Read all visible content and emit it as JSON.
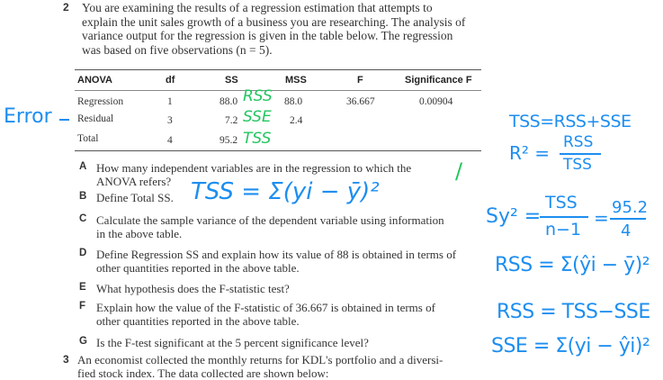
{
  "question2": {
    "number": "2",
    "intro_lines": [
      "You are examining the results of a regression estimation that attempts to",
      "explain the unit sales growth of a business you are researching. The analysis of",
      "variance output for the regression is given in the table below. The regression",
      "was based on five observations (n = 5)."
    ]
  },
  "anova": {
    "headers": [
      "ANOVA",
      "df",
      "SS",
      "MSS",
      "F",
      "Significance F"
    ],
    "rows": [
      {
        "source": "Regression",
        "df": "1",
        "ss": "88.0",
        "mss": "88.0",
        "f": "36.667",
        "sig": "0.00904"
      },
      {
        "source": "Residual",
        "df": "3",
        "ss": "7.2",
        "mss": "2.4",
        "f": "",
        "sig": ""
      },
      {
        "source": "Total",
        "df": "4",
        "ss": "95.2",
        "mss": "",
        "f": "",
        "sig": ""
      }
    ]
  },
  "subquestions": [
    {
      "letter": "A",
      "lines": [
        "How many independent variables are in the regression to which the",
        "ANOVA refers?"
      ]
    },
    {
      "letter": "B",
      "lines": [
        "Define Total SS."
      ]
    },
    {
      "letter": "C",
      "lines": [
        "Calculate the sample variance of the dependent variable using information",
        "in the above table."
      ]
    },
    {
      "letter": "D",
      "lines": [
        "Define Regression SS and explain how its value of 88 is obtained in terms of",
        "other quantities reported in the above table."
      ]
    },
    {
      "letter": "E",
      "lines": [
        "What hypothesis does the F-statistic test?"
      ]
    },
    {
      "letter": "F",
      "lines": [
        "Explain how the value of the F-statistic of 36.667 is obtained in terms of",
        "other quantities reported in the above table."
      ]
    },
    {
      "letter": "G",
      "lines": [
        "Is the F-test significant at the 5 percent significance level?"
      ]
    }
  ],
  "question3": {
    "number": "3",
    "lines": [
      "An economist collected the monthly returns for KDL's portfolio and a diversi-",
      "fied stock index. The data collected are shown below:"
    ]
  },
  "annotations": {
    "error_label": "Error",
    "rss": "RSS",
    "sse": "SSE",
    "tss": "TSS",
    "answer_a": "/",
    "answer_b": "TSS = Σ(yi − ȳ)²",
    "tss_eq": "TSS=RSS+SSE",
    "r2_lhs": "R² =",
    "r2_num": "RSS",
    "r2_den": "TSS",
    "sy_lhs": "Sy² =",
    "sy_num1": "TSS",
    "sy_den1": "n−1",
    "sy_num2": "95.2",
    "sy_den2": "4",
    "rss_def": "RSS = Σ(ŷi − ȳ)²",
    "rss_calc": "RSS = TSS−SSE",
    "sse_def": "SSE = Σ(yi − ŷi)²",
    "ink_green": "#22c55e",
    "ink_blue": "#1d8ef0"
  }
}
